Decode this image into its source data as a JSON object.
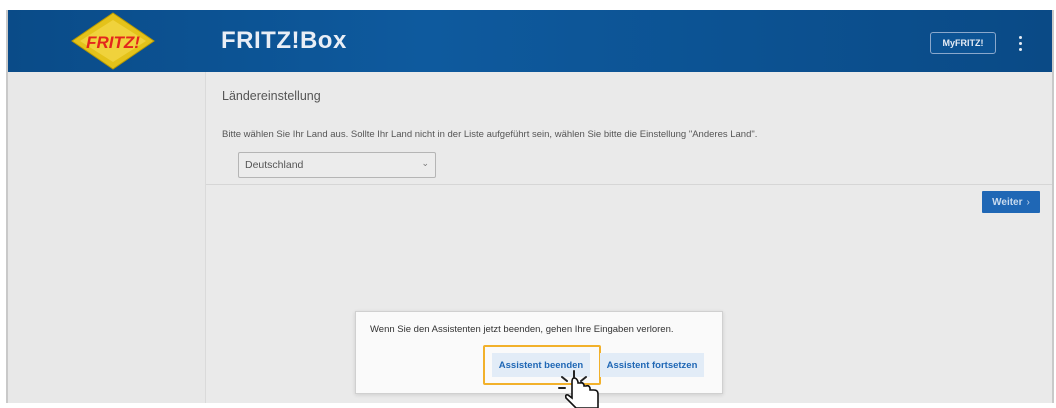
{
  "header": {
    "logo_text": "FRITZ!",
    "brand": "FRITZ!Box",
    "myfritz_label": "MyFRITZ!"
  },
  "page": {
    "section_title": "Ländereinstellung",
    "hint": "Bitte wählen Sie Ihr Land aus. Sollte Ihr Land nicht in der Liste aufgeführt sein, wählen Sie bitte die Einstellung \"Anderes Land\".",
    "country_selected": "Deutschland",
    "next_label": "Weiter"
  },
  "dialog": {
    "message": "Wenn Sie den Assistenten jetzt beenden, gehen Ihre Eingaben verloren.",
    "end_label": "Assistent beenden",
    "continue_label": "Assistent fortsetzen"
  },
  "colors": {
    "header_blue": "#0b5090",
    "accent_blue": "#1f67b5",
    "highlight": "#f2b12b"
  }
}
